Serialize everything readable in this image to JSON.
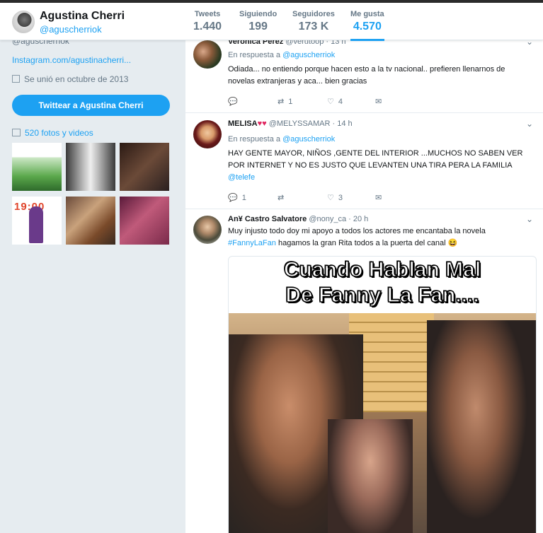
{
  "profile": {
    "name": "Agustina Cherri",
    "handle": "@aguscherriok",
    "handle_cut": "@aguscherriok",
    "instagram": "Instagram.com/agustinacherri...",
    "joined": "Se unió en octubre de 2013",
    "tweet_button": "Twittear a Agustina Cherri",
    "photos_link": "520 fotos y videos",
    "thumb_digits": "19:00"
  },
  "stats": [
    {
      "label": "Tweets",
      "value": "1.440"
    },
    {
      "label": "Siguiendo",
      "value": "199"
    },
    {
      "label": "Seguidores",
      "value": "173 K"
    },
    {
      "label": "Me gusta",
      "value": "4.570"
    }
  ],
  "tweets": [
    {
      "name": "Verónica Pérez",
      "handle": "@verutoop",
      "time": "· 13 h",
      "reply_prefix": "En respuesta a",
      "reply_to": "@aguscherriok",
      "text": "Odiada... no entiendo porque hacen esto a la tv nacional.. prefieren llenarnos de novelas extranjeras y aca... bien gracias",
      "replies": "",
      "retweets": "1",
      "likes": "4"
    },
    {
      "name": "MELISA",
      "hearts": "♥♥",
      "handle": "@MELYSSAMAR",
      "time": "· 14 h",
      "reply_prefix": "En respuesta a",
      "reply_to": "@aguscherriok",
      "text": "HAY GENTE MAYOR, NIÑOS ,GENTE DEL INTERIOR ...MUCHOS NO SABEN VER POR INTERNET Y NO ES JUSTO QUE LEVANTEN UNA TIRA PERA LA FAMILIA",
      "mention": "@telefe",
      "replies": "1",
      "retweets": "",
      "likes": "3"
    },
    {
      "name": "An¥ Castro Salvatore",
      "handle": "@nony_ca",
      "time": "· 20 h",
      "text": "Muy injusto todo doy mi apoyo a todos los actores me encantaba la novela",
      "hashtag": "#FannyLaFan",
      "text2": "hagamos la gran Rita todos a la puerta del canal 😆",
      "meme_line1": "Cuando Hablan Mal",
      "meme_line2": "De Fanny La Fan...."
    }
  ],
  "icons": {
    "reply": "💬",
    "retweet": "⇄",
    "like": "♡",
    "dm": "✉",
    "chevron": "⌄"
  },
  "colors": {
    "accent": "#1da1f2",
    "heart": "#e0245e",
    "page_bg": "#e6ecf0"
  }
}
